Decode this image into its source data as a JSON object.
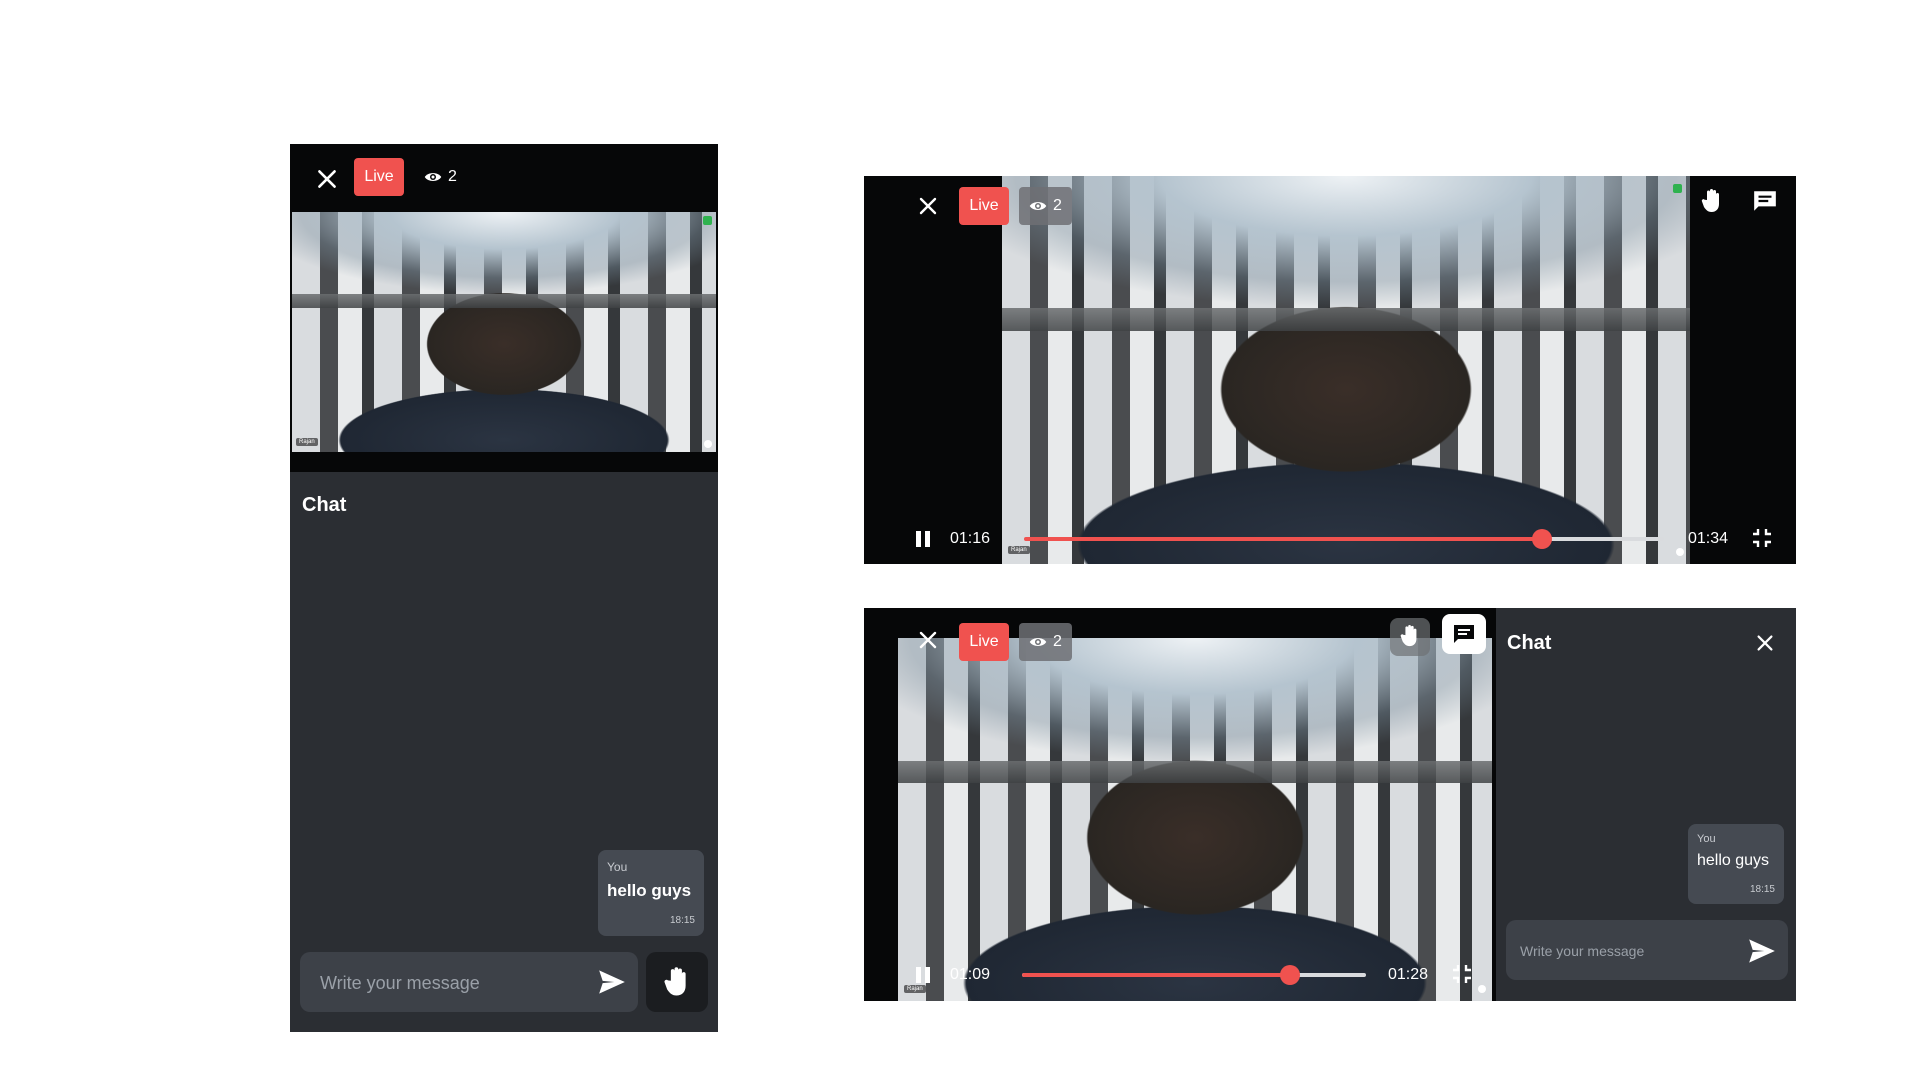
{
  "colors": {
    "live_red": "#f0524f",
    "panel_bg": "#2b2e33",
    "player_bg": "#060708"
  },
  "mobile": {
    "live_label": "Live",
    "viewer_count": "2",
    "participant_name": "Rajan",
    "chat_title": "Chat",
    "message": {
      "sender": "You",
      "text": "hello guys",
      "time": "18:15"
    },
    "input_placeholder": "Write your message"
  },
  "fullscreen": {
    "live_label": "Live",
    "viewer_count": "2",
    "participant_name": "Rajan",
    "elapsed": "01:16",
    "duration": "01:34",
    "progress": 0.81
  },
  "split": {
    "live_label": "Live",
    "viewer_count": "2",
    "participant_name": "Rajan",
    "elapsed": "01:09",
    "duration": "01:28",
    "progress": 0.78,
    "chat_title": "Chat",
    "message": {
      "sender": "You",
      "text": "hello guys",
      "time": "18:15"
    },
    "input_placeholder": "Write your message"
  }
}
